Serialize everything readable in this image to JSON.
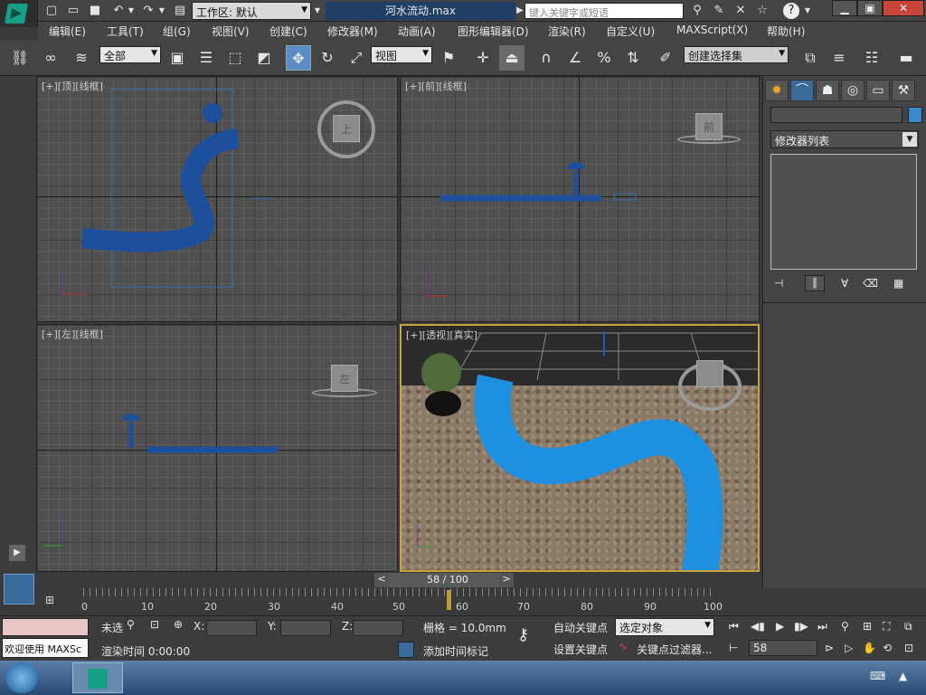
{
  "app": {
    "title": "河水流动.max",
    "workspace": "工作区: 默认",
    "search_placeholder": "键入关键字或短语"
  },
  "menu": [
    "编辑(E)",
    "工具(T)",
    "组(G)",
    "视图(V)",
    "创建(C)",
    "修改器(M)",
    "动画(A)",
    "图形编辑器(D)",
    "渲染(R)",
    "自定义(U)",
    "MAXScript(X)",
    "帮助(H)"
  ],
  "toolbar": {
    "filter": "全部",
    "ref_coord": "视图",
    "named_sel": "创建选择集"
  },
  "viewports": {
    "top": "[+][顶][线框]",
    "front": "[+][前][线框]",
    "left": "[+][左][线框]",
    "persp": "[+][透视][真实]"
  },
  "viewcube": {
    "top": "上",
    "front": "前",
    "left": "左"
  },
  "command_panel": {
    "modifier_list": "修改器列表"
  },
  "timeline": {
    "frame": "58 / 100",
    "ticks": [
      "0",
      "10",
      "20",
      "30",
      "40",
      "50",
      "60",
      "70",
      "80",
      "90",
      "100"
    ]
  },
  "status": {
    "mini_listener": "欢迎使用 MAXSc",
    "sel_info": "未选",
    "x_label": "X:",
    "y_label": "Y:",
    "z_label": "Z:",
    "grid": "栅格 = 10.0mm",
    "render_time": "渲染时间  0:00:00",
    "add_tag": "添加时间标记",
    "auto_key": "自动关键点",
    "set_key": "设置关键点",
    "key_mode": "选定对象",
    "key_filter": "关键点过滤器...",
    "current_frame": "58"
  },
  "colors": {
    "river": "#1e90e0",
    "wire": "#1e4f9c",
    "bg": "#3a3a3a",
    "active_border": "#c8a23c"
  }
}
